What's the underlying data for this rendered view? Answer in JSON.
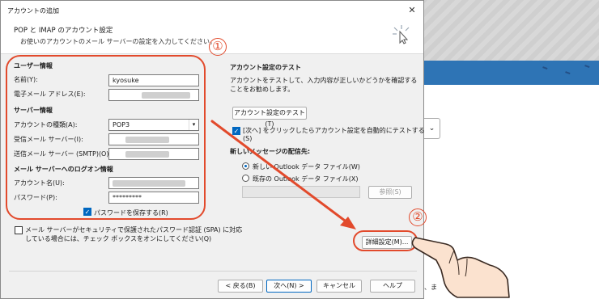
{
  "dialog": {
    "title": "アカウントの追加",
    "close_glyph": "✕",
    "header_title": "POP と IMAP のアカウント設定",
    "header_subtitle": "お使いのアカウントのメール サーバーの設定を入力してください。"
  },
  "user_info": {
    "section": "ユーザー情報",
    "name_label": "名前(Y):",
    "name_value": "kyosuke",
    "email_label": "電子メール アドレス(E):"
  },
  "server_info": {
    "section": "サーバー情報",
    "account_type_label": "アカウントの種類(A):",
    "account_type_value": "POP3",
    "incoming_label": "受信メール サーバー(I):",
    "outgoing_label": "送信メール サーバー (SMTP)(O):"
  },
  "login_info": {
    "section": "メール サーバーへのログオン情報",
    "account_label": "アカウント名(U):",
    "password_label": "パスワード(P):",
    "password_value": "*********",
    "remember_password": "パスワードを保存する(R)"
  },
  "spa": {
    "label_line1": "メール サーバーがセキュリティで保護されたパスワード認証 (SPA) に対応",
    "label_line2": "している場合には、チェック ボックスをオンにしてください(Q)"
  },
  "test": {
    "section": "アカウント設定のテスト",
    "desc": "アカウントをテストして、入力内容が正しいかどうかを確認することをお勧めします。",
    "test_button": "アカウント設定のテスト(T)",
    "auto_test_line1": "[次へ] をクリックしたらアカウント設定を自動的にテストする",
    "auto_test_line2": "(S)"
  },
  "delivery": {
    "section": "新しいメッセージの配信先:",
    "new_file": "新しい Outlook データ ファイル(W)",
    "existing_file": "既存の Outlook データ ファイル(X)",
    "browse_button": "参照(S)"
  },
  "buttons": {
    "advanced": "詳細設定(M)...",
    "back": "< 戻る(B)",
    "next": "次へ(N) >",
    "cancel": "キャンセル",
    "help": "ヘルプ"
  },
  "annotations": {
    "step1": "①",
    "step2": "②",
    "color": "#e24a2c"
  },
  "background": {
    "dropdown_glyph": "⌄",
    "partial_text": "、ま"
  }
}
